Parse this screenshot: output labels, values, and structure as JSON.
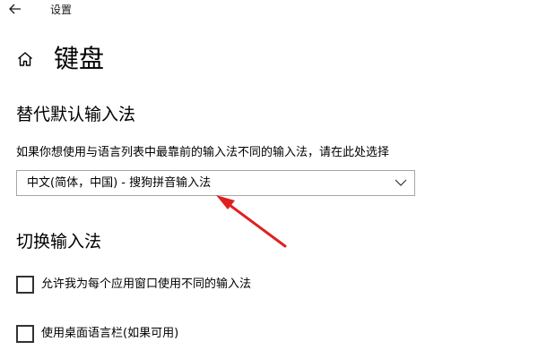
{
  "window": {
    "title": "设置",
    "back_icon": "back-arrow-icon"
  },
  "header": {
    "home_icon": "home-icon",
    "title": "键盘"
  },
  "default_input": {
    "heading": "替代默认输入法",
    "description": "如果你想使用与语言列表中最靠前的输入法不同的输入法，请在此处选择",
    "dropdown": {
      "selected": "中文(简体，中国) - 搜狗拼音输入法",
      "icon": "chevron-down-icon"
    }
  },
  "switch_input": {
    "heading": "切换输入法",
    "options": [
      {
        "label": "允许我为每个应用窗口使用不同的输入法",
        "checked": false
      },
      {
        "label": "使用桌面语言栏(如果可用)",
        "checked": false
      }
    ]
  },
  "annotation": {
    "arrow_color": "#e02020"
  }
}
